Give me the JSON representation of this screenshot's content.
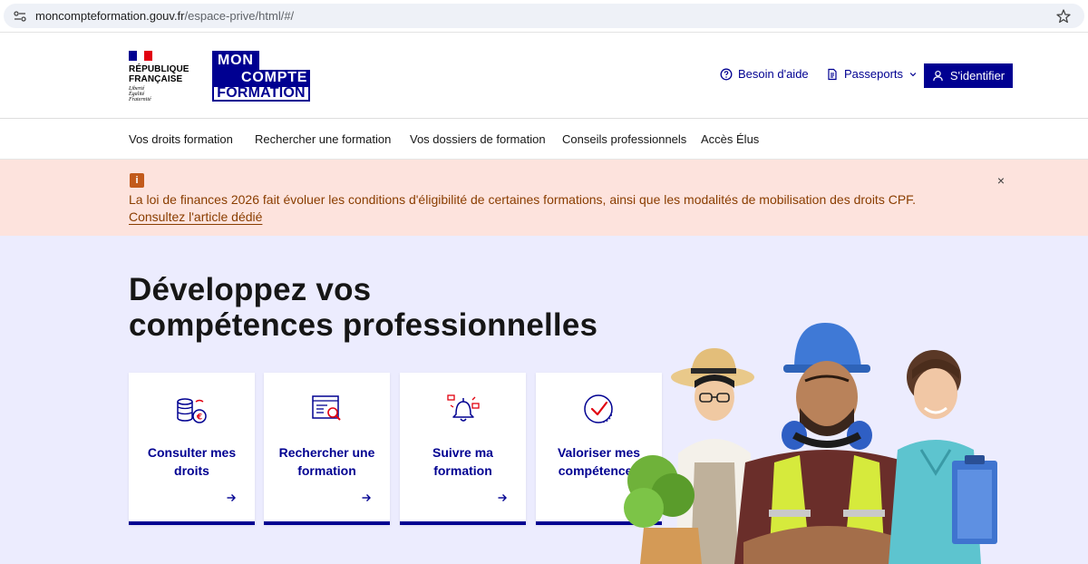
{
  "browser": {
    "url_host": "moncompteformation.gouv.fr",
    "url_path": "/espace-prive/html/#/"
  },
  "header": {
    "rf_line1": "RÉPUBLIQUE",
    "rf_line2": "FRANÇAISE",
    "rf_motto1": "Liberté",
    "rf_motto2": "Égalité",
    "rf_motto3": "Fraternité",
    "logo_word1": "MON",
    "logo_word2": "COMPTE",
    "logo_word3": "FORMATION",
    "help_label": "Besoin d'aide",
    "passports_label": "Passeports",
    "login_label": "S'identifier"
  },
  "nav": {
    "items": [
      {
        "label": "Vos droits formation"
      },
      {
        "label": "Rechercher une formation"
      },
      {
        "label": "Vos dossiers de formation"
      },
      {
        "label": "Conseils professionnels"
      },
      {
        "label": "Accès Élus"
      }
    ]
  },
  "notice": {
    "icon": "i",
    "text": "La loi de finances 2026 fait évoluer les conditions d'éligibilité de certaines formations, ainsi que les modalités de mobilisation des droits CPF.",
    "link": "Consultez l'article dédié",
    "close": "×"
  },
  "hero": {
    "title_line1": "Développez vos",
    "title_line2": "compétences professionnelles",
    "cards": [
      {
        "line1": "Consulter mes",
        "line2": "droits",
        "icon": "coins-icon"
      },
      {
        "line1": "Rechercher une",
        "line2": "formation",
        "icon": "search-document-icon"
      },
      {
        "line1": "Suivre ma",
        "line2": "formation",
        "icon": "bell-icon"
      },
      {
        "line1": "Valoriser mes",
        "line2": "compétences",
        "icon": "check-circle-icon"
      }
    ]
  },
  "colors": {
    "primary": "#000091",
    "notice_bg": "#fde3dd",
    "notice_text": "#8a3d00",
    "hero_bg": "#ececfe",
    "accent_red": "#e1000f"
  }
}
